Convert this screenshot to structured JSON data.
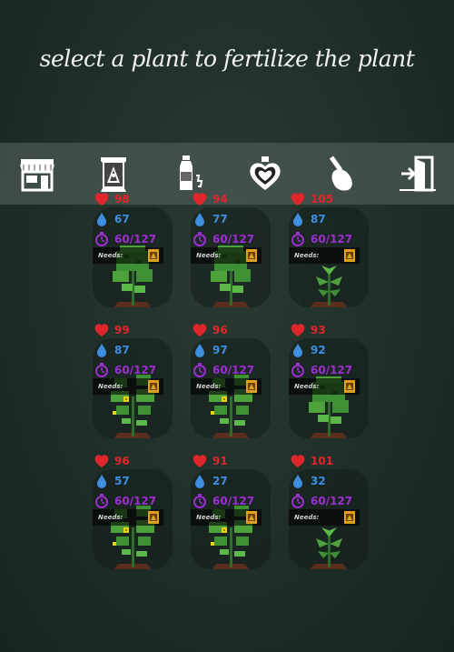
{
  "header": {
    "title": "select a plant to fertilize the plant"
  },
  "toolbar": {
    "items": [
      {
        "name": "shop",
        "icon": "shop-icon"
      },
      {
        "name": "fertilizer",
        "icon": "fertilizer-bag-icon"
      },
      {
        "name": "water",
        "icon": "water-bottle-icon"
      },
      {
        "name": "potion",
        "icon": "heart-potion-icon"
      },
      {
        "name": "shovel",
        "icon": "shovel-icon"
      },
      {
        "name": "exit",
        "icon": "exit-door-icon"
      }
    ]
  },
  "needs_label": "Needs:",
  "plants": [
    {
      "health": "98",
      "water": "67",
      "growth": "60/127",
      "kind": "bush"
    },
    {
      "health": "94",
      "water": "77",
      "growth": "60/127",
      "kind": "bush"
    },
    {
      "health": "105",
      "water": "87",
      "growth": "60/127",
      "kind": "sprout"
    },
    {
      "health": "99",
      "water": "87",
      "growth": "60/127",
      "kind": "flower-vine"
    },
    {
      "health": "96",
      "water": "97",
      "growth": "60/127",
      "kind": "flower-vine"
    },
    {
      "health": "93",
      "water": "92",
      "growth": "60/127",
      "kind": "bush-tall"
    },
    {
      "health": "96",
      "water": "57",
      "growth": "60/127",
      "kind": "flower-vine"
    },
    {
      "health": "91",
      "water": "27",
      "growth": "60/127",
      "kind": "flower-vine"
    },
    {
      "health": "101",
      "water": "32",
      "growth": "60/127",
      "kind": "sprout"
    }
  ],
  "colors": {
    "health": "#e0262a",
    "water": "#3e8fe0",
    "growth": "#9b2fd0",
    "leaf": "#3f8f35",
    "soil": "#5a2e1e"
  }
}
